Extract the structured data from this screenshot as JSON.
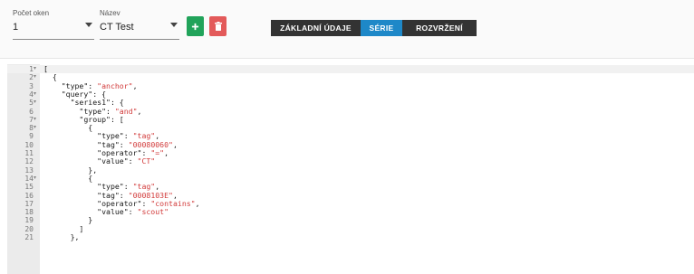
{
  "toolbar": {
    "window_count": {
      "label": "Počet oken",
      "value": "1"
    },
    "name": {
      "label": "Název",
      "value": "CT Test"
    },
    "add_button": {
      "icon": "plus-icon",
      "color": "#21a35a"
    },
    "delete_button": {
      "icon": "trash-icon",
      "color": "#e35a5a"
    },
    "tabs": [
      {
        "label": "ZÁKLADNÍ ÚDAJE",
        "active": false
      },
      {
        "label": "SÉRIE",
        "active": true
      },
      {
        "label": "ROZVRŽENÍ",
        "active": false
      }
    ],
    "active_tab_color": "#1e88c8"
  },
  "editor": {
    "lines": [
      {
        "n": "1",
        "fold": true,
        "active": true,
        "segs": [
          [
            "",
            "["
          ]
        ]
      },
      {
        "n": "2",
        "fold": true,
        "segs": [
          [
            "",
            "  {"
          ]
        ]
      },
      {
        "n": "3",
        "segs": [
          [
            "",
            "    \"type\": "
          ],
          [
            "str",
            "\"anchor\""
          ],
          [
            "",
            ","
          ]
        ]
      },
      {
        "n": "4",
        "fold": true,
        "segs": [
          [
            "",
            "    \"query\": {"
          ]
        ]
      },
      {
        "n": "5",
        "fold": true,
        "segs": [
          [
            "",
            "      \"series1\": {"
          ]
        ]
      },
      {
        "n": "6",
        "segs": [
          [
            "",
            "        \"type\": "
          ],
          [
            "str",
            "\"and\""
          ],
          [
            "",
            ","
          ]
        ]
      },
      {
        "n": "7",
        "fold": true,
        "segs": [
          [
            "",
            "        \"group\": ["
          ]
        ]
      },
      {
        "n": "8",
        "fold": true,
        "segs": [
          [
            "",
            "          {"
          ]
        ]
      },
      {
        "n": "9",
        "segs": [
          [
            "",
            "            \"type\": "
          ],
          [
            "str",
            "\"tag\""
          ],
          [
            "",
            ","
          ]
        ]
      },
      {
        "n": "10",
        "segs": [
          [
            "",
            "            \"tag\": "
          ],
          [
            "str",
            "\"00080060\""
          ],
          [
            "",
            ","
          ]
        ]
      },
      {
        "n": "11",
        "segs": [
          [
            "",
            "            \"operator\": "
          ],
          [
            "str",
            "\"=\""
          ],
          [
            "",
            ","
          ]
        ]
      },
      {
        "n": "12",
        "segs": [
          [
            "",
            "            \"value\": "
          ],
          [
            "str",
            "\"CT\""
          ]
        ]
      },
      {
        "n": "13",
        "segs": [
          [
            "",
            "          },"
          ]
        ]
      },
      {
        "n": "14",
        "fold": true,
        "segs": [
          [
            "",
            "          {"
          ]
        ]
      },
      {
        "n": "15",
        "segs": [
          [
            "",
            "            \"type\": "
          ],
          [
            "str",
            "\"tag\""
          ],
          [
            "",
            ","
          ]
        ]
      },
      {
        "n": "16",
        "segs": [
          [
            "",
            "            \"tag\": "
          ],
          [
            "str",
            "\"0008103E\""
          ],
          [
            "",
            ","
          ]
        ]
      },
      {
        "n": "17",
        "segs": [
          [
            "",
            "            \"operator\": "
          ],
          [
            "str",
            "\"contains\""
          ],
          [
            "",
            ","
          ]
        ]
      },
      {
        "n": "18",
        "segs": [
          [
            "",
            "            \"value\": "
          ],
          [
            "str",
            "\"scout\""
          ]
        ]
      },
      {
        "n": "19",
        "segs": [
          [
            "",
            "          }"
          ]
        ]
      },
      {
        "n": "20",
        "segs": [
          [
            "",
            "        ]"
          ]
        ]
      },
      {
        "n": "21",
        "segs": [
          [
            "",
            "      },"
          ]
        ]
      }
    ]
  }
}
